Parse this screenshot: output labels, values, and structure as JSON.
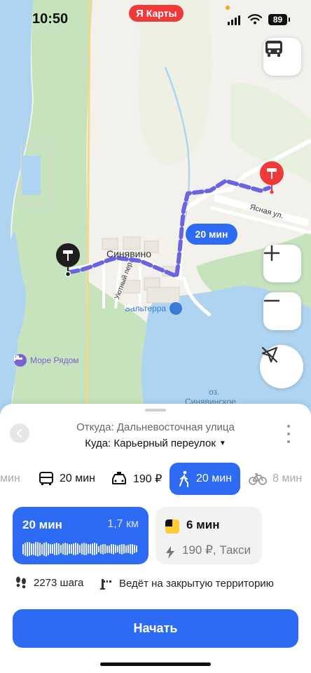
{
  "status_bar": {
    "time": "10:50",
    "battery": "89",
    "brand": {
      "letter": "Я",
      "name": "Карты",
      "color": "#f03a3a"
    }
  },
  "map": {
    "labels": {
      "village": "Синявино",
      "street_yasnaya": "Ясная ул.",
      "street_uyutny": "Уютный пер.",
      "lake": "оз.",
      "lake_name": "Синявинское"
    },
    "pois": [
      {
        "name": "Вальтерра",
        "icon": "bed-icon",
        "color": "#3a7bd5"
      },
      {
        "name": "Море Рядом",
        "icon": "bed-icon",
        "color": "#7b61d1"
      }
    ],
    "route_badge": "20 мин",
    "route_color": "#6b63e0",
    "buttons": {
      "transport": "bus-icon",
      "zoom_in": "plus-icon",
      "zoom_out": "minus-icon",
      "location": "location-off-icon"
    }
  },
  "sheet": {
    "from": "Откуда: Дальневосточная улица",
    "to": "Куда: Карьерный переулок",
    "modes": [
      {
        "icon": "car-icon",
        "label": "мин",
        "active": false
      },
      {
        "icon": "bus-icon",
        "label": "20 мин",
        "active": false
      },
      {
        "icon": "taxi-icon",
        "label": "190 ₽",
        "active": false
      },
      {
        "icon": "walk-icon",
        "label": "20 мин",
        "active": true
      },
      {
        "icon": "bicycle-icon",
        "label": "8 мин",
        "active": false
      }
    ],
    "route_card": {
      "time": "20 мин",
      "distance": "1,7 км"
    },
    "taxi_card": {
      "time": "6 мин",
      "price": "190 ₽, Такси"
    },
    "info": {
      "steps": "2273 шага",
      "warning": "Ведёт на закрытую территорию"
    },
    "start_label": "Начать"
  },
  "colors": {
    "accent": "#2e6bf5",
    "water": "#aed4f2",
    "forest": "#bfe0b8"
  }
}
